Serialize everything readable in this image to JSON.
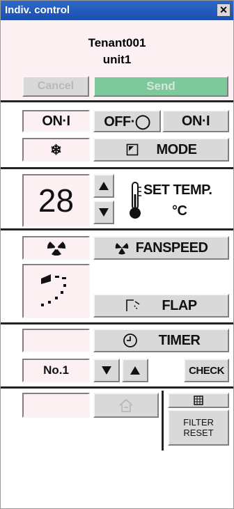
{
  "window": {
    "title": "Indiv. control",
    "close_glyph": "✕"
  },
  "header": {
    "tenant": "Tenant001",
    "unit": "unit1",
    "cancel_label": "Cancel",
    "send_label": "Send"
  },
  "operation": {
    "on_label": "ON·I",
    "off_label": "OFF·◯",
    "on2_label": "ON·I"
  },
  "mode": {
    "label": "MODE",
    "current_icon": "snowflake-icon"
  },
  "temperature": {
    "value": "28",
    "label": "SET TEMP.",
    "unit": "°C"
  },
  "fan": {
    "label": "FANSPEED",
    "current_icon": "fan-icon"
  },
  "flap": {
    "label": "FLAP"
  },
  "timer": {
    "label": "TIMER",
    "number": "No.1",
    "check_label": "CHECK"
  },
  "filter": {
    "reset_line1": "FILTER",
    "reset_line2": "RESET"
  },
  "colors": {
    "titlebar": "#1b4fb0",
    "send_button": "#7ec99c",
    "panel": "#fdf0f2",
    "button": "#d9d9d9"
  }
}
